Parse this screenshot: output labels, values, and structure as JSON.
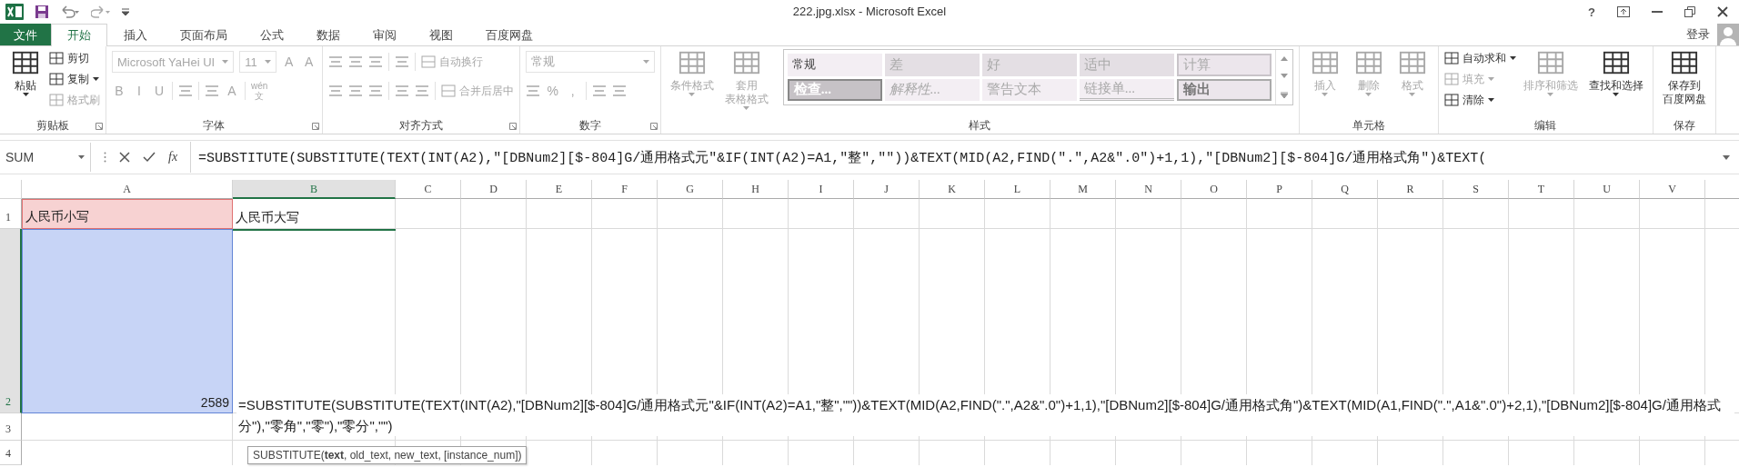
{
  "window": {
    "title": "222.jpg.xlsx - Microsoft Excel",
    "help": "?"
  },
  "tabs": [
    {
      "label": "文件",
      "kind": "file",
      "selected": false
    },
    {
      "label": "开始",
      "kind": "tab",
      "selected": true
    },
    {
      "label": "插入",
      "kind": "tab",
      "selected": false
    },
    {
      "label": "页面布局",
      "kind": "tab",
      "selected": false
    },
    {
      "label": "公式",
      "kind": "tab",
      "selected": false
    },
    {
      "label": "数据",
      "kind": "tab",
      "selected": false
    },
    {
      "label": "审阅",
      "kind": "tab",
      "selected": false
    },
    {
      "label": "视图",
      "kind": "tab",
      "selected": false
    },
    {
      "label": "百度网盘",
      "kind": "tab",
      "selected": false
    }
  ],
  "account": {
    "label": "登录"
  },
  "ribbon": [
    {
      "label": "剪贴板",
      "launcher": true,
      "blocks": [
        {
          "kind": "large",
          "lines": [
            "粘贴"
          ],
          "dropdown": true,
          "disabled": false
        },
        {
          "kind": "stack",
          "items": [
            {
              "label": "剪切",
              "dropdown": false,
              "disabled": false
            },
            {
              "label": "复制",
              "dropdown": true,
              "disabled": false
            },
            {
              "label": "格式刷",
              "dropdown": false,
              "disabled": true
            }
          ]
        }
      ]
    },
    {
      "label": "字体",
      "launcher": true,
      "blocks": [
        {
          "kind": "rows",
          "rows": [
            {
              "items": [
                {
                  "kind": "field",
                  "value": "Microsoft YaHei UI",
                  "disabled": true
                },
                {
                  "kind": "field",
                  "value": "11",
                  "disabled": true
                },
                {
                  "kind": "text",
                  "label": "A",
                  "disabled": true
                },
                {
                  "kind": "text",
                  "label": "A",
                  "disabled": true
                }
              ]
            },
            {
              "items": [
                {
                  "kind": "text",
                  "label": "B",
                  "disabled": true
                },
                {
                  "kind": "text",
                  "label": "I",
                  "disabled": true
                },
                {
                  "kind": "text",
                  "label": "U",
                  "disabled": true
                },
                {
                  "kind": "sep"
                },
                {
                  "kind": "icon",
                  "disabled": true
                },
                {
                  "kind": "sep"
                },
                {
                  "kind": "icon",
                  "disabled": true
                },
                {
                  "kind": "text",
                  "label": "A",
                  "disabled": true
                },
                {
                  "kind": "sep"
                },
                {
                  "kind": "text",
                  "lines": [
                    "wén",
                    "文"
                  ],
                  "disabled": true
                }
              ]
            }
          ]
        }
      ]
    },
    {
      "label": "对齐方式",
      "launcher": true,
      "blocks": [
        {
          "kind": "rows",
          "rows": [
            {
              "items": [
                {
                  "kind": "icon",
                  "disabled": true
                },
                {
                  "kind": "icon",
                  "disabled": true
                },
                {
                  "kind": "icon",
                  "disabled": true
                },
                {
                  "kind": "sep"
                },
                {
                  "kind": "icon",
                  "disabled": true
                },
                {
                  "kind": "sep"
                },
                {
                  "kind": "labeled",
                  "label": "自动换行",
                  "disabled": true
                }
              ]
            },
            {
              "items": [
                {
                  "kind": "icon",
                  "disabled": true
                },
                {
                  "kind": "icon",
                  "disabled": true
                },
                {
                  "kind": "icon",
                  "disabled": true
                },
                {
                  "kind": "sep"
                },
                {
                  "kind": "icon",
                  "disabled": true
                },
                {
                  "kind": "icon",
                  "disabled": true
                },
                {
                  "kind": "sep"
                },
                {
                  "kind": "labeled",
                  "label": "合并后居中",
                  "disabled": true
                }
              ]
            }
          ]
        }
      ]
    },
    {
      "label": "数字",
      "launcher": true,
      "blocks": [
        {
          "kind": "rows",
          "rows": [
            {
              "items": [
                {
                  "kind": "field",
                  "value": "常规",
                  "disabled": true
                }
              ]
            },
            {
              "items": [
                {
                  "kind": "icon",
                  "disabled": true
                },
                {
                  "kind": "text",
                  "label": "%",
                  "disabled": true
                },
                {
                  "kind": "text",
                  "label": ",",
                  "disabled": true
                },
                {
                  "kind": "sep"
                },
                {
                  "kind": "icon",
                  "disabled": true
                },
                {
                  "kind": "icon",
                  "disabled": true
                }
              ]
            }
          ]
        }
      ]
    },
    {
      "label": "样式",
      "blocks": [
        {
          "kind": "large",
          "lines": [
            "条件格式"
          ],
          "dropdown": true,
          "disabled": true
        },
        {
          "kind": "large",
          "lines": [
            "套用",
            "表格格式"
          ],
          "dropdown": true,
          "disabled": true
        },
        {
          "kind": "gallery",
          "cells": [
            {
              "label": "常规"
            },
            {
              "label": "差"
            },
            {
              "label": "好"
            },
            {
              "label": "适中"
            },
            {
              "label": "计算"
            },
            {
              "label": "检查..."
            },
            {
              "label": "解释性..."
            },
            {
              "label": "警告文本"
            },
            {
              "label": "链接单..."
            },
            {
              "label": "输出"
            }
          ]
        }
      ]
    },
    {
      "label": "单元格",
      "blocks": [
        {
          "kind": "large",
          "lines": [
            "插入"
          ],
          "dropdown": true,
          "disabled": true
        },
        {
          "kind": "large",
          "lines": [
            "删除"
          ],
          "dropdown": true,
          "disabled": true
        },
        {
          "kind": "large",
          "lines": [
            "格式"
          ],
          "dropdown": true,
          "disabled": true
        }
      ]
    },
    {
      "label": "编辑",
      "blocks": [
        {
          "kind": "stack",
          "items": [
            {
              "label": "自动求和",
              "dropdown": true,
              "disabled": false
            },
            {
              "label": "填充",
              "dropdown": true,
              "disabled": true
            },
            {
              "label": "清除",
              "dropdown": true,
              "disabled": false
            }
          ]
        },
        {
          "kind": "large",
          "lines": [
            "排序和筛选"
          ],
          "dropdown": true,
          "disabled": true
        },
        {
          "kind": "large",
          "lines": [
            "查找和选择"
          ],
          "dropdown": true,
          "disabled": false
        }
      ]
    },
    {
      "label": "保存",
      "blocks": [
        {
          "kind": "large",
          "lines": [
            "保存到",
            "百度网盘"
          ],
          "dropdown": false,
          "disabled": false
        }
      ]
    }
  ],
  "formula_bar": {
    "name_box": "SUM",
    "fx": "fx",
    "formula": "=SUBSTITUTE(SUBSTITUTE(TEXT(INT(A2),\"[DBNum2][$-804]G/通用格式元\"&IF(INT(A2)=A1,\"整\",\"\"))&TEXT(MID(A2,FIND(\".\",A2&\".0\")+1,1),\"[DBNum2][$-804]G/通用格式角\")&TEXT("
  },
  "grid": {
    "columns": [
      {
        "label": "A",
        "selected": false
      },
      {
        "label": "B",
        "selected": true
      },
      {
        "label": "C",
        "selected": false
      },
      {
        "label": "D",
        "selected": false
      },
      {
        "label": "E",
        "selected": false
      },
      {
        "label": "F",
        "selected": false
      },
      {
        "label": "G",
        "selected": false
      },
      {
        "label": "H",
        "selected": false
      },
      {
        "label": "I",
        "selected": false
      },
      {
        "label": "J",
        "selected": false
      },
      {
        "label": "K",
        "selected": false
      },
      {
        "label": "L",
        "selected": false
      },
      {
        "label": "M",
        "selected": false
      },
      {
        "label": "N",
        "selected": false
      },
      {
        "label": "O",
        "selected": false
      },
      {
        "label": "P",
        "selected": false
      },
      {
        "label": "Q",
        "selected": false
      },
      {
        "label": "R",
        "selected": false
      },
      {
        "label": "S",
        "selected": false
      },
      {
        "label": "T",
        "selected": false
      },
      {
        "label": "U",
        "selected": false
      },
      {
        "label": "V",
        "selected": false
      }
    ],
    "rows": [
      {
        "label": "1",
        "selected": false,
        "cells": [
          {
            "kind": "text",
            "value": "人民币小写",
            "color": "#f7d2d2"
          },
          {
            "kind": "text",
            "value": "人民币大写"
          }
        ]
      },
      {
        "label": "2",
        "selected": true,
        "cells": [
          {
            "kind": "number",
            "value": "2589",
            "color": "#c7d4f6"
          },
          {
            "kind": "formula",
            "editing": true,
            "value": "=SUBSTITUTE(SUBSTITUTE(TEXT(INT(A2),\"[DBNum2][$-804]G/通用格式元\"&IF(INT(A2)=A1,\"整\",\"\"))&TEXT(MID(A2,FIND(\".\",A2&\".0\")+1,1),\"[DBNum2][$-804]G/通用格式角\")&TEXT(MID(A1,FIND(\".\",A1&\".0\")+2,1),\"[DBNum2][$-804]G/通用格式分\"),\"零角\",\"零\"),\"零分\",\"\")"
          }
        ]
      },
      {
        "label": "3",
        "selected": false,
        "cells": []
      },
      {
        "label": "4",
        "selected": false,
        "cells": []
      }
    ],
    "tooltip": "SUBSTITUTE(**text**, old_text, new_text, [instance_num])"
  }
}
